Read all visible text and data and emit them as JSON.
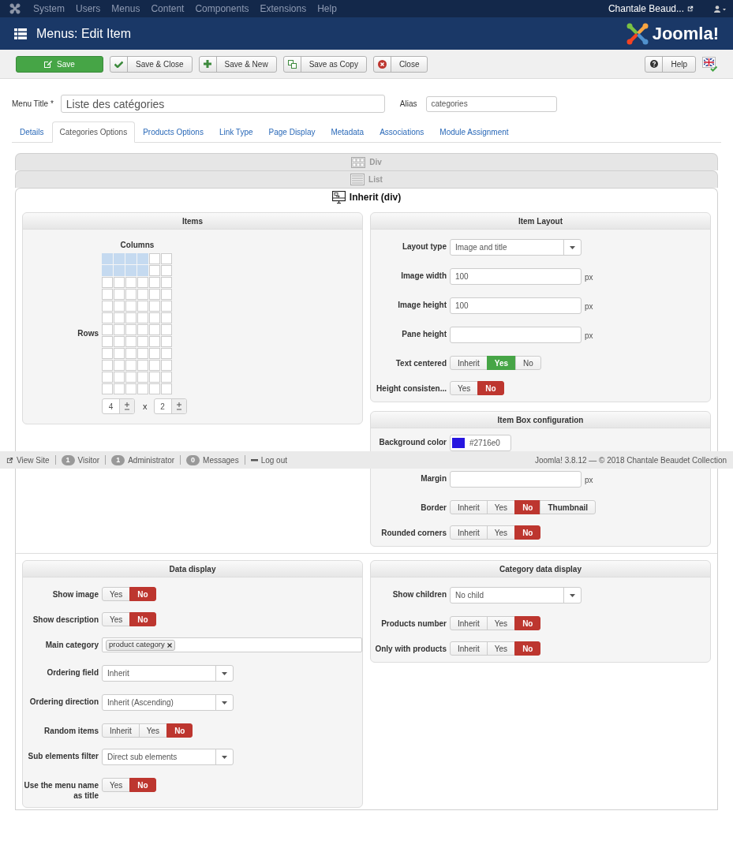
{
  "topbar": {
    "menu": [
      "System",
      "Users",
      "Menus",
      "Content",
      "Components",
      "Extensions",
      "Help"
    ],
    "user": "Chantale Beaud..."
  },
  "header": {
    "title": "Menus: Edit Item",
    "logo": "Joomla!"
  },
  "toolbar": {
    "buttons": [
      {
        "label": "Save",
        "kind": "save"
      },
      {
        "label": "Save & Close",
        "kind": "check"
      },
      {
        "label": "Save & New",
        "kind": "plus"
      },
      {
        "label": "Save as Copy",
        "kind": "copy"
      },
      {
        "label": "Close",
        "kind": "close"
      }
    ],
    "help": "Help"
  },
  "menu_title": {
    "label": "Menu Title *",
    "value": "Liste des catégories"
  },
  "alias": {
    "label": "Alias",
    "value": "categories"
  },
  "tabs": [
    {
      "label": "Details",
      "selected": false
    },
    {
      "label": "Categories Options",
      "selected": true
    },
    {
      "label": "Products Options",
      "selected": false
    },
    {
      "label": "Link Type",
      "selected": false
    },
    {
      "label": "Page Display",
      "selected": false
    },
    {
      "label": "Metadata",
      "selected": false
    },
    {
      "label": "Associations",
      "selected": false
    },
    {
      "label": "Module Assignment",
      "selected": false
    }
  ],
  "layout_options": [
    {
      "label": "Div",
      "kind": "div",
      "selected": false
    },
    {
      "label": "List",
      "kind": "list",
      "selected": false
    },
    {
      "label": "Inherit (div)",
      "kind": "inherit",
      "selected": true
    }
  ],
  "items_panel": {
    "title": "Items",
    "columns_label": "Columns",
    "rows_label": "Rows",
    "columns_value": "4",
    "times": "x",
    "rows_value": "2",
    "grid": [
      {
        "cells": [
          {
            "selected": true
          },
          {
            "selected": true
          },
          {
            "selected": true
          },
          {
            "selected": true
          },
          {
            "selected": false
          },
          {
            "selected": false
          }
        ]
      },
      {
        "cells": [
          {
            "selected": true
          },
          {
            "selected": true
          },
          {
            "selected": true
          },
          {
            "selected": true
          },
          {
            "selected": false
          },
          {
            "selected": false
          }
        ]
      },
      {
        "cells": [
          {
            "selected": false
          },
          {
            "selected": false
          },
          {
            "selected": false
          },
          {
            "selected": false
          },
          {
            "selected": false
          },
          {
            "selected": false
          }
        ]
      },
      {
        "cells": [
          {
            "selected": false
          },
          {
            "selected": false
          },
          {
            "selected": false
          },
          {
            "selected": false
          },
          {
            "selected": false
          },
          {
            "selected": false
          }
        ]
      },
      {
        "cells": [
          {
            "selected": false
          },
          {
            "selected": false
          },
          {
            "selected": false
          },
          {
            "selected": false
          },
          {
            "selected": false
          },
          {
            "selected": false
          }
        ]
      },
      {
        "cells": [
          {
            "selected": false
          },
          {
            "selected": false
          },
          {
            "selected": false
          },
          {
            "selected": false
          },
          {
            "selected": false
          },
          {
            "selected": false
          }
        ]
      },
      {
        "cells": [
          {
            "selected": false
          },
          {
            "selected": false
          },
          {
            "selected": false
          },
          {
            "selected": false
          },
          {
            "selected": false
          },
          {
            "selected": false
          }
        ]
      },
      {
        "cells": [
          {
            "selected": false
          },
          {
            "selected": false
          },
          {
            "selected": false
          },
          {
            "selected": false
          },
          {
            "selected": false
          },
          {
            "selected": false
          }
        ]
      },
      {
        "cells": [
          {
            "selected": false
          },
          {
            "selected": false
          },
          {
            "selected": false
          },
          {
            "selected": false
          },
          {
            "selected": false
          },
          {
            "selected": false
          }
        ]
      },
      {
        "cells": [
          {
            "selected": false
          },
          {
            "selected": false
          },
          {
            "selected": false
          },
          {
            "selected": false
          },
          {
            "selected": false
          },
          {
            "selected": false
          }
        ]
      },
      {
        "cells": [
          {
            "selected": false
          },
          {
            "selected": false
          },
          {
            "selected": false
          },
          {
            "selected": false
          },
          {
            "selected": false
          },
          {
            "selected": false
          }
        ]
      },
      {
        "cells": [
          {
            "selected": false
          },
          {
            "selected": false
          },
          {
            "selected": false
          },
          {
            "selected": false
          },
          {
            "selected": false
          },
          {
            "selected": false
          }
        ]
      }
    ]
  },
  "item_layout": {
    "title": "Item Layout",
    "fields": [
      {
        "label": "Layout type",
        "kind": "select",
        "value": "Image and title"
      },
      {
        "label": "Image width",
        "kind": "input",
        "value": "100",
        "unit": "px"
      },
      {
        "label": "Image height",
        "kind": "input",
        "value": "100",
        "unit": "px"
      },
      {
        "label": "Pane height",
        "kind": "input",
        "unit": "px"
      },
      {
        "label": "Text centered",
        "kind": "toggle",
        "options": [
          {
            "label": "Inherit",
            "kind": "inherit",
            "selected": false
          },
          {
            "label": "Yes",
            "kind": "yes",
            "selected": true
          },
          {
            "label": "No",
            "kind": "no",
            "selected": false
          }
        ]
      },
      {
        "label": "Height consisten...",
        "kind": "toggle",
        "options": [
          {
            "label": "Yes",
            "kind": "yes",
            "selected": false
          },
          {
            "label": "No",
            "kind": "no",
            "selected": true
          }
        ]
      }
    ]
  },
  "item_box": {
    "title": "Item Box configuration",
    "fields": [
      {
        "label": "Background color",
        "kind": "color",
        "color": "#2716e0",
        "value": "#2716e0"
      },
      {
        "label": "Margin",
        "kind": "input",
        "unit": "px"
      },
      {
        "label": "Border",
        "kind": "toggle",
        "options": [
          {
            "label": "Inherit",
            "kind": "inherit",
            "selected": false
          },
          {
            "label": "Yes",
            "kind": "yes",
            "selected": false
          },
          {
            "label": "No",
            "kind": "no",
            "selected": true
          },
          {
            "label": "Thumbnail",
            "kind": "other",
            "selected": false
          }
        ]
      },
      {
        "label": "Rounded corners",
        "kind": "toggle",
        "options": [
          {
            "label": "Inherit",
            "kind": "inherit",
            "selected": false
          },
          {
            "label": "Yes",
            "kind": "yes",
            "selected": false
          },
          {
            "label": "No",
            "kind": "no",
            "selected": true
          }
        ]
      }
    ]
  },
  "data_display": {
    "title": "Data display",
    "fields": [
      {
        "label": "Show image",
        "kind": "toggle",
        "options": [
          {
            "label": "Yes",
            "kind": "yes",
            "selected": false
          },
          {
            "label": "No",
            "kind": "no",
            "selected": true
          }
        ]
      },
      {
        "label": "Show description",
        "kind": "toggle",
        "options": [
          {
            "label": "Yes",
            "kind": "yes",
            "selected": false
          },
          {
            "label": "No",
            "kind": "no",
            "selected": true
          }
        ]
      },
      {
        "label": "Main category",
        "kind": "tags",
        "tags": [
          "product category"
        ]
      },
      {
        "label": "Ordering field",
        "kind": "select",
        "value": "Inherit"
      },
      {
        "label": "Ordering direction",
        "kind": "select",
        "value": "Inherit (Ascending)"
      },
      {
        "label": "Random items",
        "kind": "toggle",
        "options": [
          {
            "label": "Inherit",
            "kind": "inherit",
            "selected": false
          },
          {
            "label": "Yes",
            "kind": "yes",
            "selected": false
          },
          {
            "label": "No",
            "kind": "no",
            "selected": true
          }
        ]
      },
      {
        "label": "Sub elements filter",
        "kind": "select",
        "value": "Direct sub elements"
      },
      {
        "label": "Use the menu name as title",
        "kind": "toggle",
        "options": [
          {
            "label": "Yes",
            "kind": "yes",
            "selected": false
          },
          {
            "label": "No",
            "kind": "no",
            "selected": true
          }
        ]
      }
    ]
  },
  "category_data_display": {
    "title": "Category data display",
    "fields": [
      {
        "label": "Show children",
        "kind": "select",
        "value": "No child"
      },
      {
        "label": "Products number",
        "kind": "toggle",
        "options": [
          {
            "label": "Inherit",
            "kind": "inherit",
            "selected": false
          },
          {
            "label": "Yes",
            "kind": "yes",
            "selected": false
          },
          {
            "label": "No",
            "kind": "no",
            "selected": true
          }
        ]
      },
      {
        "label": "Only with products",
        "kind": "toggle",
        "options": [
          {
            "label": "Inherit",
            "kind": "inherit",
            "selected": false
          },
          {
            "label": "Yes",
            "kind": "yes",
            "selected": false
          },
          {
            "label": "No",
            "kind": "no",
            "selected": true
          }
        ]
      }
    ]
  },
  "status_bar": {
    "items": [
      {
        "label": "View Site",
        "kind": "link"
      },
      {
        "label": "Visitor",
        "kind": "count",
        "count": "1"
      },
      {
        "label": "Administrator",
        "kind": "count",
        "count": "1"
      },
      {
        "label": "Messages",
        "kind": "count",
        "count": "0"
      },
      {
        "label": "Log out",
        "kind": "logout"
      }
    ],
    "copyright": "Joomla! 3.8.12 — © 2018 Chantale Beaudet Collection"
  }
}
